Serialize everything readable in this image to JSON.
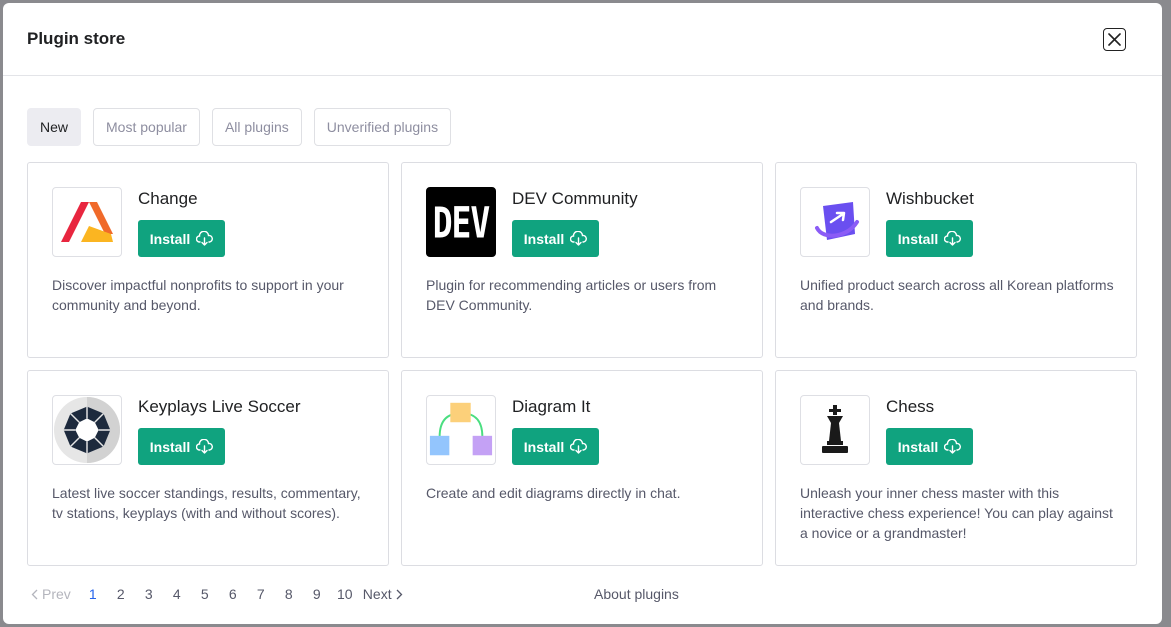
{
  "modal": {
    "title": "Plugin store"
  },
  "tabs": [
    {
      "label": "New",
      "active": true
    },
    {
      "label": "Most popular",
      "active": false
    },
    {
      "label": "All plugins",
      "active": false
    },
    {
      "label": "Unverified plugins",
      "active": false
    }
  ],
  "plugins": [
    {
      "name": "Change",
      "install_label": "Install",
      "description": "Discover impactful nonprofits to support in your community and beyond.",
      "icon": "change-logo"
    },
    {
      "name": "DEV Community",
      "install_label": "Install",
      "description": "Plugin for recommending articles or users from DEV Community.",
      "icon": "dev-logo",
      "logo_text": "DEV"
    },
    {
      "name": "Wishbucket",
      "install_label": "Install",
      "description": "Unified product search across all Korean platforms and brands.",
      "icon": "wishbucket-logo"
    },
    {
      "name": "Keyplays Live Soccer",
      "install_label": "Install",
      "description": "Latest live soccer standings, results, commentary, tv stations, keyplays (with and without scores).",
      "icon": "soccer-ball-logo"
    },
    {
      "name": "Diagram It",
      "install_label": "Install",
      "description": "Create and edit diagrams directly in chat.",
      "icon": "diagram-logo"
    },
    {
      "name": "Chess",
      "install_label": "Install",
      "description": "Unleash your inner chess master with this interactive chess experience! You can play against a novice or a grandmaster!",
      "icon": "chess-king-logo"
    }
  ],
  "pagination": {
    "prev_label": "Prev",
    "next_label": "Next",
    "pages": [
      "1",
      "2",
      "3",
      "4",
      "5",
      "6",
      "7",
      "8",
      "9",
      "10"
    ],
    "current": "1"
  },
  "about_label": "About plugins",
  "colors": {
    "install": "#10a37f",
    "active_page": "#2563eb"
  }
}
